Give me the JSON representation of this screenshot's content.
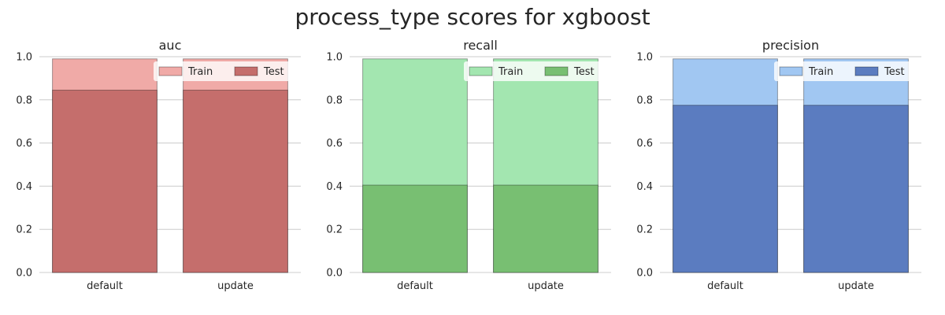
{
  "figure": {
    "title": "process_type scores for xgboost"
  },
  "chart_data": [
    {
      "type": "bar",
      "title": "auc",
      "categories": [
        "default",
        "update"
      ],
      "series": [
        {
          "name": "Train",
          "values": [
            0.99,
            0.99
          ]
        },
        {
          "name": "Test",
          "values": [
            0.845,
            0.845
          ]
        }
      ],
      "ylim": [
        0,
        1
      ],
      "yticks": [
        "0.0",
        "0.2",
        "0.4",
        "0.6",
        "0.8",
        "1.0"
      ],
      "grid": true,
      "legend": "top-right",
      "colors": {
        "Train": "#f0aaa7",
        "Test": "#c56e6c"
      }
    },
    {
      "type": "bar",
      "title": "recall",
      "categories": [
        "default",
        "update"
      ],
      "series": [
        {
          "name": "Train",
          "values": [
            0.99,
            0.99
          ]
        },
        {
          "name": "Test",
          "values": [
            0.405,
            0.405
          ]
        }
      ],
      "ylim": [
        0,
        1
      ],
      "yticks": [
        "0.0",
        "0.2",
        "0.4",
        "0.6",
        "0.8",
        "1.0"
      ],
      "grid": true,
      "legend": "top-right",
      "colors": {
        "Train": "#a3e6b0",
        "Test": "#78bf72"
      }
    },
    {
      "type": "bar",
      "title": "precision",
      "categories": [
        "default",
        "update"
      ],
      "series": [
        {
          "name": "Train",
          "values": [
            0.99,
            0.99
          ]
        },
        {
          "name": "Test",
          "values": [
            0.775,
            0.775
          ]
        }
      ],
      "ylim": [
        0,
        1
      ],
      "yticks": [
        "0.0",
        "0.2",
        "0.4",
        "0.6",
        "0.8",
        "1.0"
      ],
      "grid": true,
      "legend": "top-right",
      "colors": {
        "Train": "#a1c7f2",
        "Test": "#5b7cc0"
      }
    }
  ]
}
